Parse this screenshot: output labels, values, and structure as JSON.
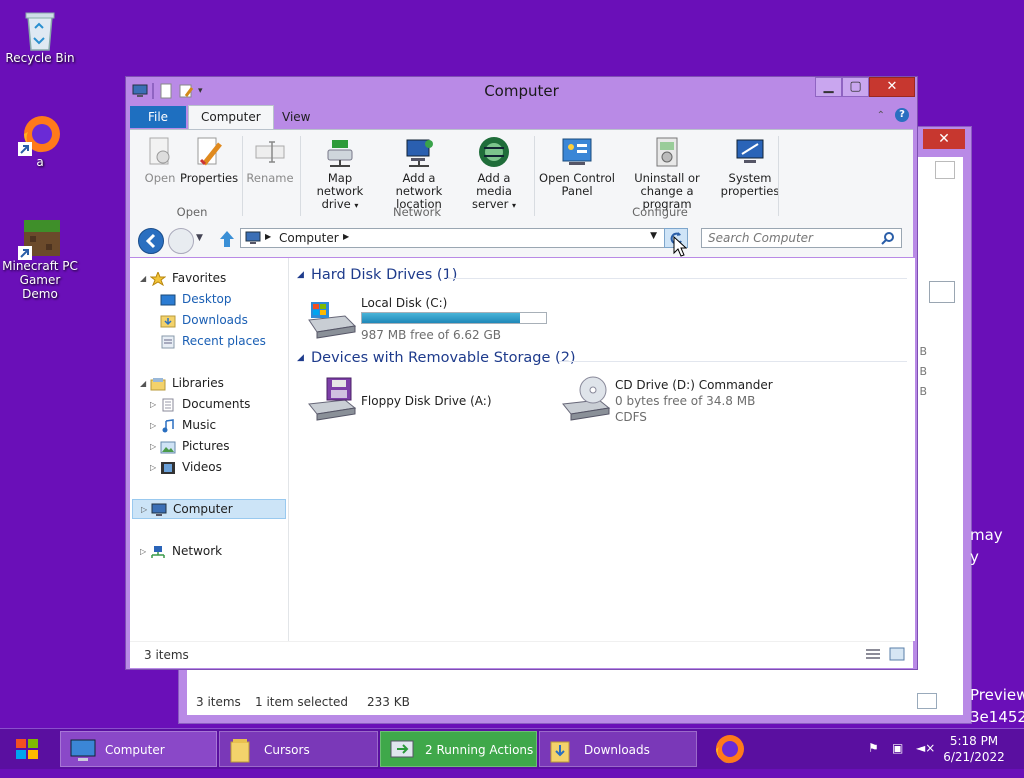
{
  "desktop": {
    "icons": [
      {
        "label": "Recycle Bin"
      },
      {
        "label": "a"
      },
      {
        "label": "Minecraft PC Gamer Demo"
      }
    ],
    "overflow_text": [
      "may",
      "y",
      "Preview",
      "3e1452"
    ]
  },
  "back_window": {
    "status_items": "3 items",
    "status_selected": "1 item selected",
    "status_size": "233 KB",
    "side_values": [
      "B",
      "B",
      "B"
    ]
  },
  "window": {
    "title": "Computer",
    "tabs": {
      "file": "File",
      "computer": "Computer",
      "view": "View"
    },
    "ribbon": {
      "open": "Open",
      "properties": "Properties",
      "rename": "Rename",
      "map_network_drive": [
        "Map network",
        "drive"
      ],
      "add_network_location": [
        "Add a network",
        "location"
      ],
      "add_media_server": [
        "Add a media",
        "server"
      ],
      "open_control_panel": [
        "Open Control",
        "Panel"
      ],
      "uninstall_program": [
        "Uninstall or",
        "change a program"
      ],
      "system_properties": [
        "System",
        "properties"
      ],
      "groups": {
        "open": "Open",
        "network": "Network",
        "configure": "Configure"
      }
    },
    "address": {
      "crumb": "Computer",
      "search_placeholder": "Search Computer"
    },
    "nav": {
      "favorites": "Favorites",
      "desktop": "Desktop",
      "downloads": "Downloads",
      "recent": "Recent places",
      "libraries": "Libraries",
      "documents": "Documents",
      "music": "Music",
      "pictures": "Pictures",
      "videos": "Videos",
      "computer": "Computer",
      "network": "Network"
    },
    "content": {
      "hdd_header": "Hard Disk Drives (1)",
      "local_disk": {
        "name": "Local Disk (C:)",
        "free": "987 MB free of 6.62 GB",
        "used_fraction": 0.86
      },
      "removable_header": "Devices with Removable Storage (2)",
      "floppy": {
        "name": "Floppy Disk Drive (A:)"
      },
      "cd": {
        "name": "CD Drive (D:) Commander",
        "free": "0 bytes free of 34.8 MB",
        "fs": "CDFS"
      }
    },
    "status": {
      "items": "3 items"
    }
  },
  "taskbar": {
    "buttons": [
      {
        "label": "Computer"
      },
      {
        "label": "Cursors"
      },
      {
        "label": "2 Running Actions"
      },
      {
        "label": "Downloads"
      }
    ],
    "clock": {
      "time": "5:18 PM",
      "date": "6/21/2022"
    }
  }
}
